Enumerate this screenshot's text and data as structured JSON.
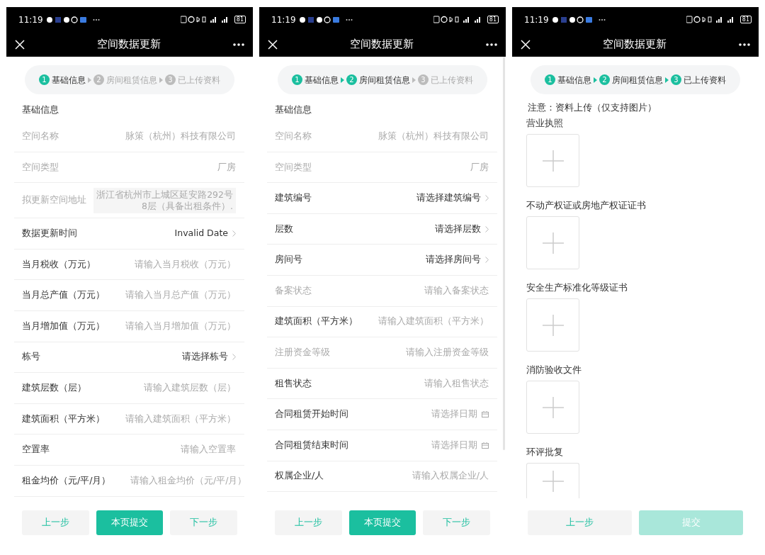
{
  "screens": [
    {
      "status_bar": {
        "time": "11:19",
        "battery": "81"
      },
      "title": "空间数据更新",
      "steps": [
        {
          "number": "1",
          "label": "基础信息",
          "done": true
        },
        {
          "number": "2",
          "label": "房间租赁信息",
          "done": false
        },
        {
          "number": "3",
          "label": "已上传资料",
          "done": false
        }
      ],
      "section_title": "基础信息",
      "rows": [
        {
          "kind": "text",
          "label": "空间名称",
          "value": "脉策（杭州）科技有限公司",
          "disabled": true
        },
        {
          "kind": "text",
          "label": "空间类型",
          "value": "厂房",
          "disabled": true
        },
        {
          "kind": "multiline",
          "label": "拟更新空间地址",
          "value_lines": [
            "浙江省杭州市上城区延安路292号",
            "8层（具备出租条件）."
          ],
          "disabled": true
        },
        {
          "kind": "select",
          "label": "数据更新时间",
          "value": "Invalid Date",
          "disabled": false
        },
        {
          "kind": "input",
          "label": "当月税收（万元）",
          "placeholder": "请输入当月税收（万元）",
          "disabled": false
        },
        {
          "kind": "input",
          "label": "当月总产值（万元）",
          "placeholder": "请输入当月总产值（万元）",
          "disabled": false
        },
        {
          "kind": "input",
          "label": "当月增加值（万元）",
          "placeholder": "请输入当月增加值（万元）",
          "disabled": false
        },
        {
          "kind": "select",
          "label": "栋号",
          "value": "请选择栋号",
          "disabled": false
        },
        {
          "kind": "input",
          "label": "建筑层数（层）",
          "placeholder": "请输入建筑层数（层）",
          "disabled": false
        },
        {
          "kind": "input",
          "label": "建筑面积（平方米）",
          "placeholder": "请输入建筑面积（平方米）",
          "disabled": false
        },
        {
          "kind": "input",
          "label": "空置率",
          "placeholder": "请输入空置率",
          "disabled": false
        },
        {
          "kind": "input",
          "label": "租金均价（元/平/月）",
          "placeholder": "请输入租金均价（元/平/月）",
          "disabled": false
        }
      ],
      "buttons": [
        {
          "label": "上一步",
          "kind": "secondary",
          "disabled": false
        },
        {
          "label": "本页提交",
          "kind": "primary",
          "disabled": false
        },
        {
          "label": "下一步",
          "kind": "secondary",
          "disabled": false
        }
      ]
    },
    {
      "status_bar": {
        "time": "11:19",
        "battery": "81"
      },
      "title": "空间数据更新",
      "scrollbar": true,
      "steps": [
        {
          "number": "1",
          "label": "基础信息",
          "done": true
        },
        {
          "number": "2",
          "label": "房间租赁信息",
          "done": true
        },
        {
          "number": "3",
          "label": "已上传资料",
          "done": false
        }
      ],
      "section_title": "基础信息",
      "rows": [
        {
          "kind": "text",
          "label": "空间名称",
          "value": "脉策（杭州）科技有限公司",
          "disabled": true
        },
        {
          "kind": "text",
          "label": "空间类型",
          "value": "厂房",
          "disabled": true
        },
        {
          "kind": "select",
          "label": "建筑编号",
          "value": "请选择建筑编号",
          "disabled": false
        },
        {
          "kind": "select",
          "label": "层数",
          "value": "请选择层数",
          "disabled": false
        },
        {
          "kind": "select",
          "label": "房间号",
          "value": "请选择房间号",
          "disabled": false
        },
        {
          "kind": "input",
          "label": "备案状态",
          "placeholder": "请输入备案状态",
          "disabled": true
        },
        {
          "kind": "input",
          "label": "建筑面积（平方米）",
          "placeholder": "请输入建筑面积（平方米）",
          "disabled": false
        },
        {
          "kind": "input",
          "label": "注册资金等级",
          "placeholder": "请输入注册资金等级",
          "disabled": true
        },
        {
          "kind": "input",
          "label": "租售状态",
          "placeholder": "请输入租售状态",
          "disabled": false
        },
        {
          "kind": "date",
          "label": "合同租赁开始时间",
          "placeholder": "请选择日期",
          "disabled": false
        },
        {
          "kind": "date",
          "label": "合同租赁结束时间",
          "placeholder": "请选择日期",
          "disabled": false
        },
        {
          "kind": "input",
          "label": "权属企业/人",
          "placeholder": "请输入权属企业/人",
          "disabled": false
        }
      ],
      "buttons": [
        {
          "label": "上一步",
          "kind": "secondary",
          "disabled": false
        },
        {
          "label": "本页提交",
          "kind": "primary",
          "disabled": false
        },
        {
          "label": "下一步",
          "kind": "secondary",
          "disabled": false
        }
      ]
    },
    {
      "status_bar": {
        "time": "11:19",
        "battery": "81"
      },
      "title": "空间数据更新",
      "steps": [
        {
          "number": "1",
          "label": "基础信息",
          "done": true
        },
        {
          "number": "2",
          "label": "房间租赁信息",
          "done": true
        },
        {
          "number": "3",
          "label": "已上传资料",
          "done": true
        }
      ],
      "notice": "注意：资料上传（仅支持图片）",
      "uploads": [
        {
          "label": "营业执照"
        },
        {
          "label": "不动产权证或房地产权证证书"
        },
        {
          "label": "安全生产标准化等级证书"
        },
        {
          "label": "消防验收文件"
        },
        {
          "label": "环评批复"
        }
      ],
      "buttons": [
        {
          "label": "上一步",
          "kind": "secondary",
          "disabled": false
        },
        {
          "label": "提交",
          "kind": "primary",
          "disabled": true
        }
      ]
    }
  ]
}
